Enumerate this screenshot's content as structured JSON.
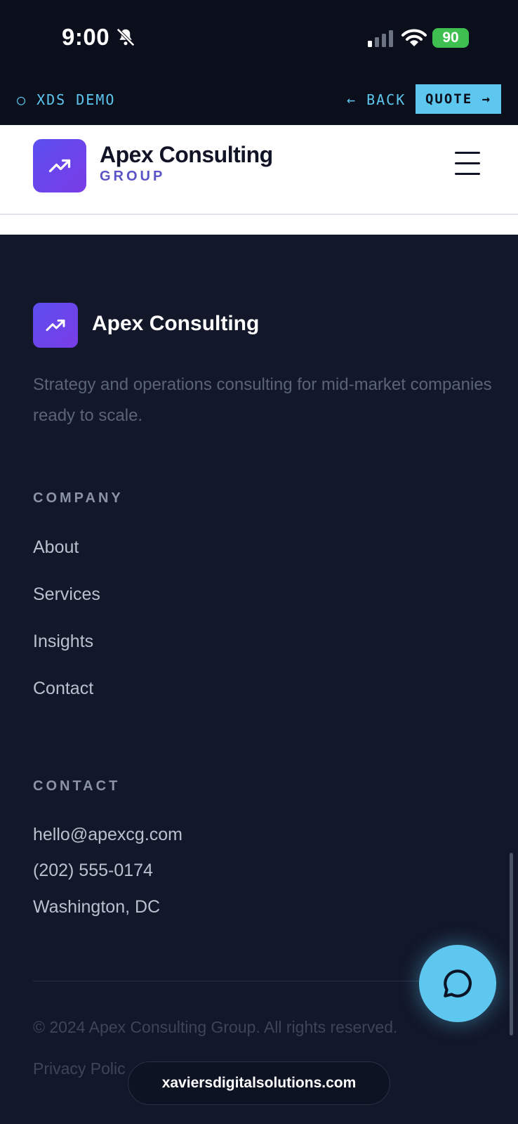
{
  "status_bar": {
    "time": "9:00",
    "battery": "90"
  },
  "demo_bar": {
    "label": "○ XDS DEMO",
    "back": "← BACK",
    "quote": "QUOTE →"
  },
  "header": {
    "brand_name": "Apex Consulting",
    "brand_sub": "GROUP"
  },
  "footer": {
    "brand_name": "Apex Consulting",
    "tagline": "Strategy and operations consulting for mid-market companies ready to scale.",
    "company": {
      "title": "COMPANY",
      "links": [
        "About",
        "Services",
        "Insights",
        "Contact"
      ]
    },
    "contact": {
      "title": "CONTACT",
      "email": "hello@apexcg.com",
      "phone": "(202) 555-0174",
      "location": "Washington, DC"
    },
    "copyright": "© 2024 Apex Consulting Group. All rights reserved.",
    "legal_link": "Privacy Polic"
  },
  "domain_pill": "xaviersdigitalsolutions.com",
  "colors": {
    "accent": "#5ec7ef",
    "brand": "#5b4ff0",
    "background": "#121729"
  },
  "icons": [
    "bell-slash-icon",
    "signal-icon",
    "wifi-icon",
    "trending-up-icon",
    "menu-icon",
    "chat-icon"
  ]
}
